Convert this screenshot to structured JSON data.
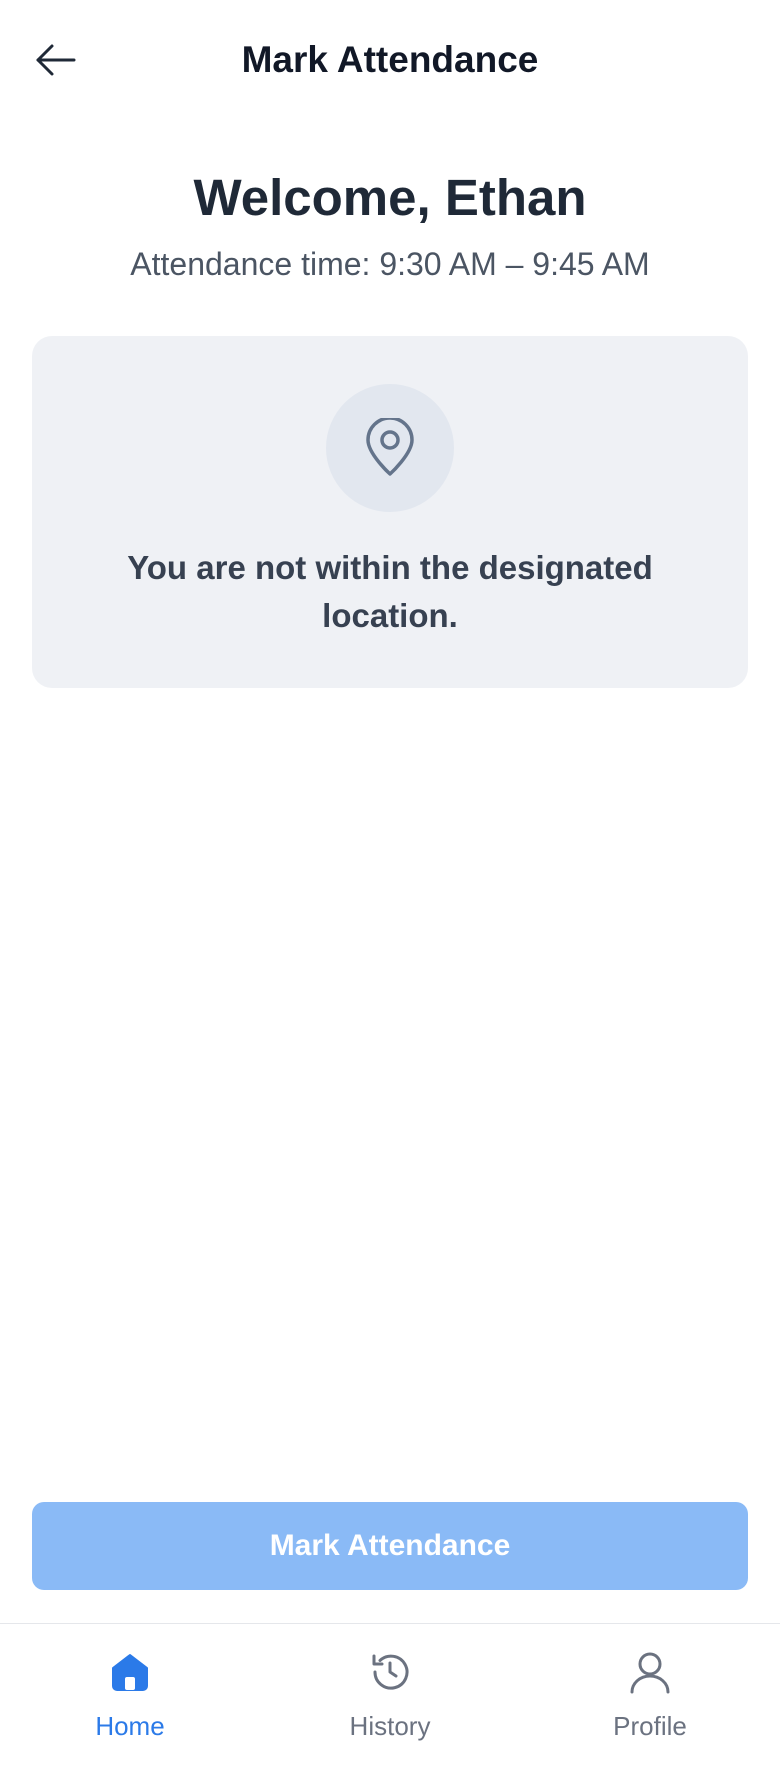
{
  "header": {
    "title": "Mark Attendance"
  },
  "welcome": {
    "greeting": "Welcome, Ethan",
    "attendance_time": "Attendance time: 9:30 AM – 9:45 AM"
  },
  "location_status": {
    "icon": "map-pin-icon",
    "message": "You are not within the designated location."
  },
  "action": {
    "mark_label": "Mark Attendance",
    "enabled": false
  },
  "nav": {
    "items": [
      {
        "label": "Home",
        "icon": "home-icon",
        "active": true
      },
      {
        "label": "History",
        "icon": "history-icon",
        "active": false
      },
      {
        "label": "Profile",
        "icon": "user-icon",
        "active": false
      }
    ]
  },
  "colors": {
    "accent": "#2b7ae8",
    "button_disabled": "#8abaf6",
    "card_bg": "#eff1f5",
    "text_primary": "#1f2937",
    "text_secondary": "#4b5563"
  }
}
